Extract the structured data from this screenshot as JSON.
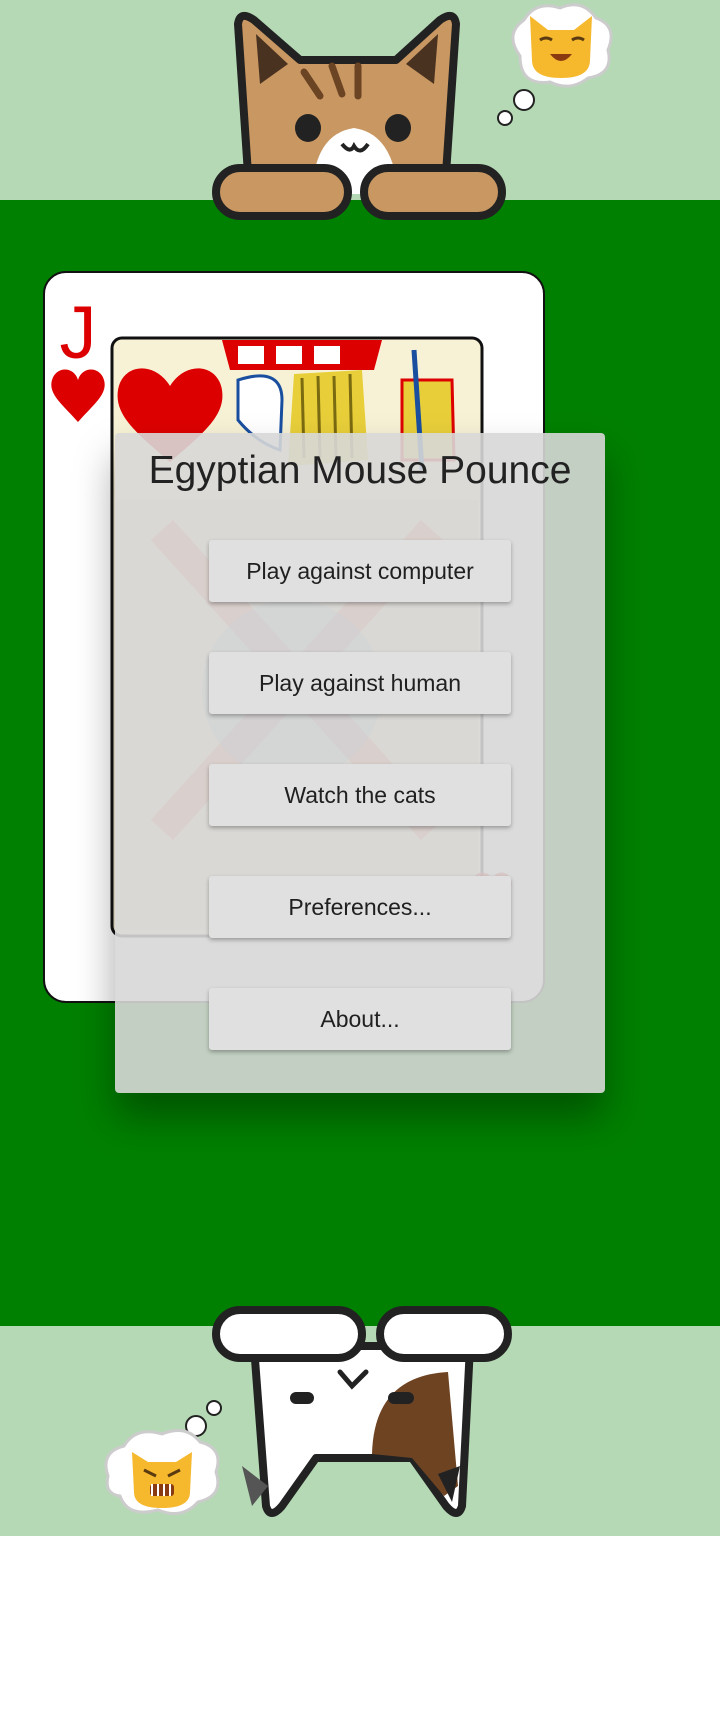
{
  "menu": {
    "title": "Egyptian Mouse Pounce",
    "buttons": [
      {
        "label": "Play against computer"
      },
      {
        "label": "Play against human"
      },
      {
        "label": "Watch the cats"
      },
      {
        "label": "Preferences..."
      },
      {
        "label": "About..."
      }
    ]
  },
  "card": {
    "rank": "J",
    "suit": "hearts",
    "suit_color": "#dd0000"
  },
  "players": {
    "top": {
      "cat": "tabby-cat",
      "mood_icon": "happy-cat-face-icon"
    },
    "bottom": {
      "cat": "calico-cat",
      "mood_icon": "angry-cat-face-icon"
    }
  },
  "colors": {
    "table": "#008000",
    "player_band": "#b4d9b4",
    "background": "#ffffff"
  }
}
